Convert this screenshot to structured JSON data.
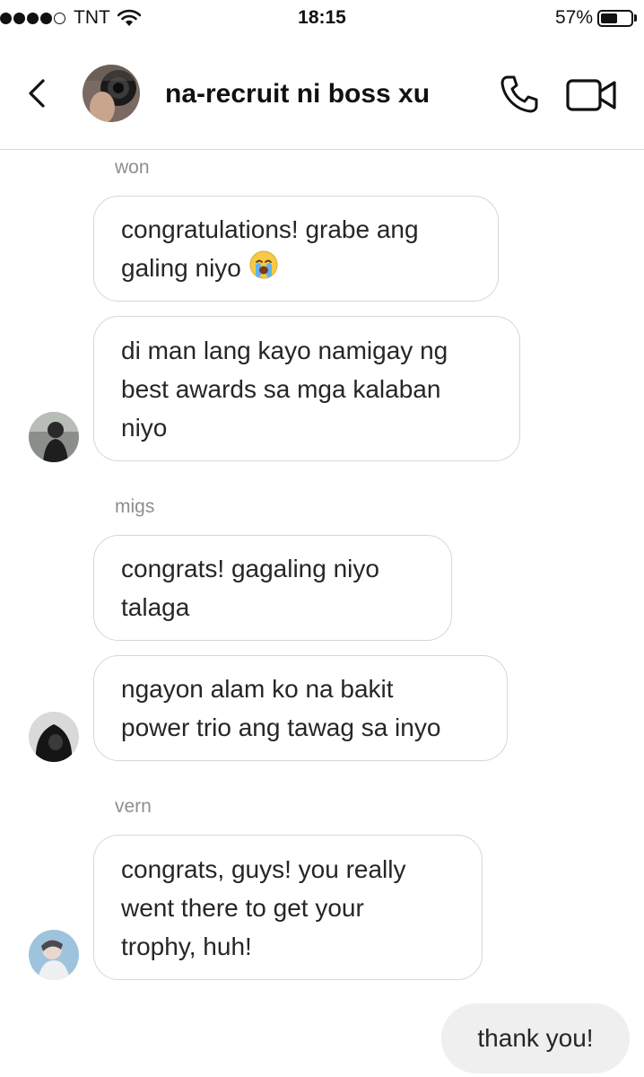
{
  "status_bar": {
    "carrier": "TNT",
    "time": "18:15",
    "battery_percent_label": "57%",
    "battery_level": 0.57,
    "signal_bars_filled": 4,
    "signal_bars_total": 5
  },
  "header": {
    "title": "na-recruit ni boss xu",
    "back_icon": "chevron-left-icon",
    "call_icon": "phone-icon",
    "video_icon": "video-camera-icon"
  },
  "messages": [
    {
      "sender": "won",
      "bubbles": [
        "congratulations! grabe ang\ngaling niyo",
        "di man lang kayo namigay ng\nbest awards sa mga kalaban\nniyo"
      ],
      "emoji": "loudly-crying-face-emoji"
    },
    {
      "sender": "migs",
      "bubbles": [
        "congrats! gagaling niyo\ntalaga",
        "ngayon alam ko na bakit\npower trio ang tawag sa inyo"
      ]
    },
    {
      "sender": "vern",
      "bubbles": [
        "congrats, guys! you really\nwent there to get your\ntrophy, huh!"
      ]
    }
  ],
  "outgoing": {
    "text": "thank you!"
  },
  "colors": {
    "outgoing_bubble": "#efefef",
    "bubble_border": "#d6d6d6",
    "sender_name": "#8e8e8e",
    "text": "#262626"
  }
}
